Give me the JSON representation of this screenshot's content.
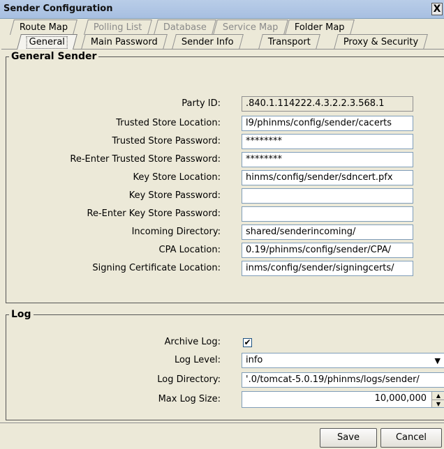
{
  "window": {
    "title": "Sender Configuration",
    "close_glyph": "X"
  },
  "tabs_row1": [
    {
      "label": "Route Map",
      "state": "normal"
    },
    {
      "label": "Polling List",
      "state": "disabled"
    },
    {
      "label": "Database",
      "state": "disabled"
    },
    {
      "label": "Service Map",
      "state": "disabled"
    },
    {
      "label": "Folder Map",
      "state": "normal"
    }
  ],
  "tabs_row2": [
    {
      "label": "General",
      "state": "selected"
    },
    {
      "label": "Main Password",
      "state": "normal"
    },
    {
      "label": "Sender Info",
      "state": "normal"
    },
    {
      "label": "Transport",
      "state": "normal"
    },
    {
      "label": "Proxy & Security",
      "state": "normal"
    }
  ],
  "general": {
    "legend": "General Sender",
    "fields": [
      {
        "label": "Party ID:",
        "value": ".840.1.114222.4.3.2.2.3.568.1",
        "readonly": true
      },
      {
        "label": "Trusted Store Location:",
        "value": "l9/phinms/config/sender/cacerts",
        "readonly": false
      },
      {
        "label": "Trusted Store Password:",
        "value": "********",
        "readonly": false
      },
      {
        "label": "Re-Enter Trusted Store Password:",
        "value": "********",
        "readonly": false
      },
      {
        "label": "Key Store Location:",
        "value": "hinms/config/sender/sdncert.pfx",
        "readonly": false
      },
      {
        "label": "Key Store Password:",
        "value": "",
        "readonly": false
      },
      {
        "label": "Re-Enter Key Store Password:",
        "value": "",
        "readonly": false
      },
      {
        "label": "Incoming Directory:",
        "value": "shared/senderincoming/",
        "readonly": false
      },
      {
        "label": "CPA Location:",
        "value": "0.19/phinms/config/sender/CPA/",
        "readonly": false
      },
      {
        "label": "Signing Certificate Location:",
        "value": "inms/config/sender/signingcerts/",
        "readonly": false
      }
    ]
  },
  "log": {
    "legend": "Log",
    "archive_label": "Archive Log:",
    "archive_checked": true,
    "archive_glyph": "✔",
    "level_label": "Log Level:",
    "level_value": "info",
    "dir_label": "Log Directory:",
    "dir_value": "'.0/tomcat-5.0.19/phinms/logs/sender/",
    "size_label": "Max Log Size:",
    "size_value": "10,000,000"
  },
  "buttons": {
    "save": "Save",
    "cancel": "Cancel"
  },
  "icons": {
    "dropdown": "chevron-down-icon",
    "spin_up": "spin-up-icon",
    "spin_down": "spin-down-icon"
  }
}
